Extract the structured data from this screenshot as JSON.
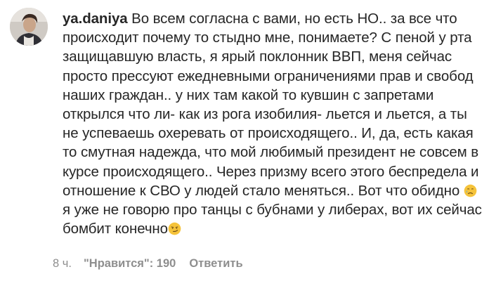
{
  "comment": {
    "username": "ya.daniya",
    "text_part1": "Во всем согласна с вами, но есть НО.. за все что происходит почему то стыдно мне, понимаете? С пеной у рта защищавшую власть, я ярый поклонник ВВП, меня сейчас просто прессуют ежедневными ограничениями прав и свобод наших граждан.. у них там какой то кувшин с запретами открылся что ли- как из рога изобилия- льется и льется, а ты не успеваешь охеревать от происходящего.. И, да, есть какая то смутная надежда, что мой любимый президент не совсем в курсе происходящего.. Через призму всего этого беспредела и отношение к СВО у людей стало меняться.. Вот что обидно ",
    "emoji1": "crying-face-icon",
    "text_part2": "я уже не говорю про танцы с бубнами у либерах, вот их сейчас бомбит конечно",
    "emoji2": "smirking-face-icon",
    "time": "8 ч.",
    "likes": "\"Нравится\": 190",
    "reply_label": "Ответить"
  },
  "colors": {
    "text": "#262626",
    "meta": "#8e8e8e",
    "emoji_yellow": "#f5c33b",
    "tear_blue": "#5aa7e6"
  }
}
